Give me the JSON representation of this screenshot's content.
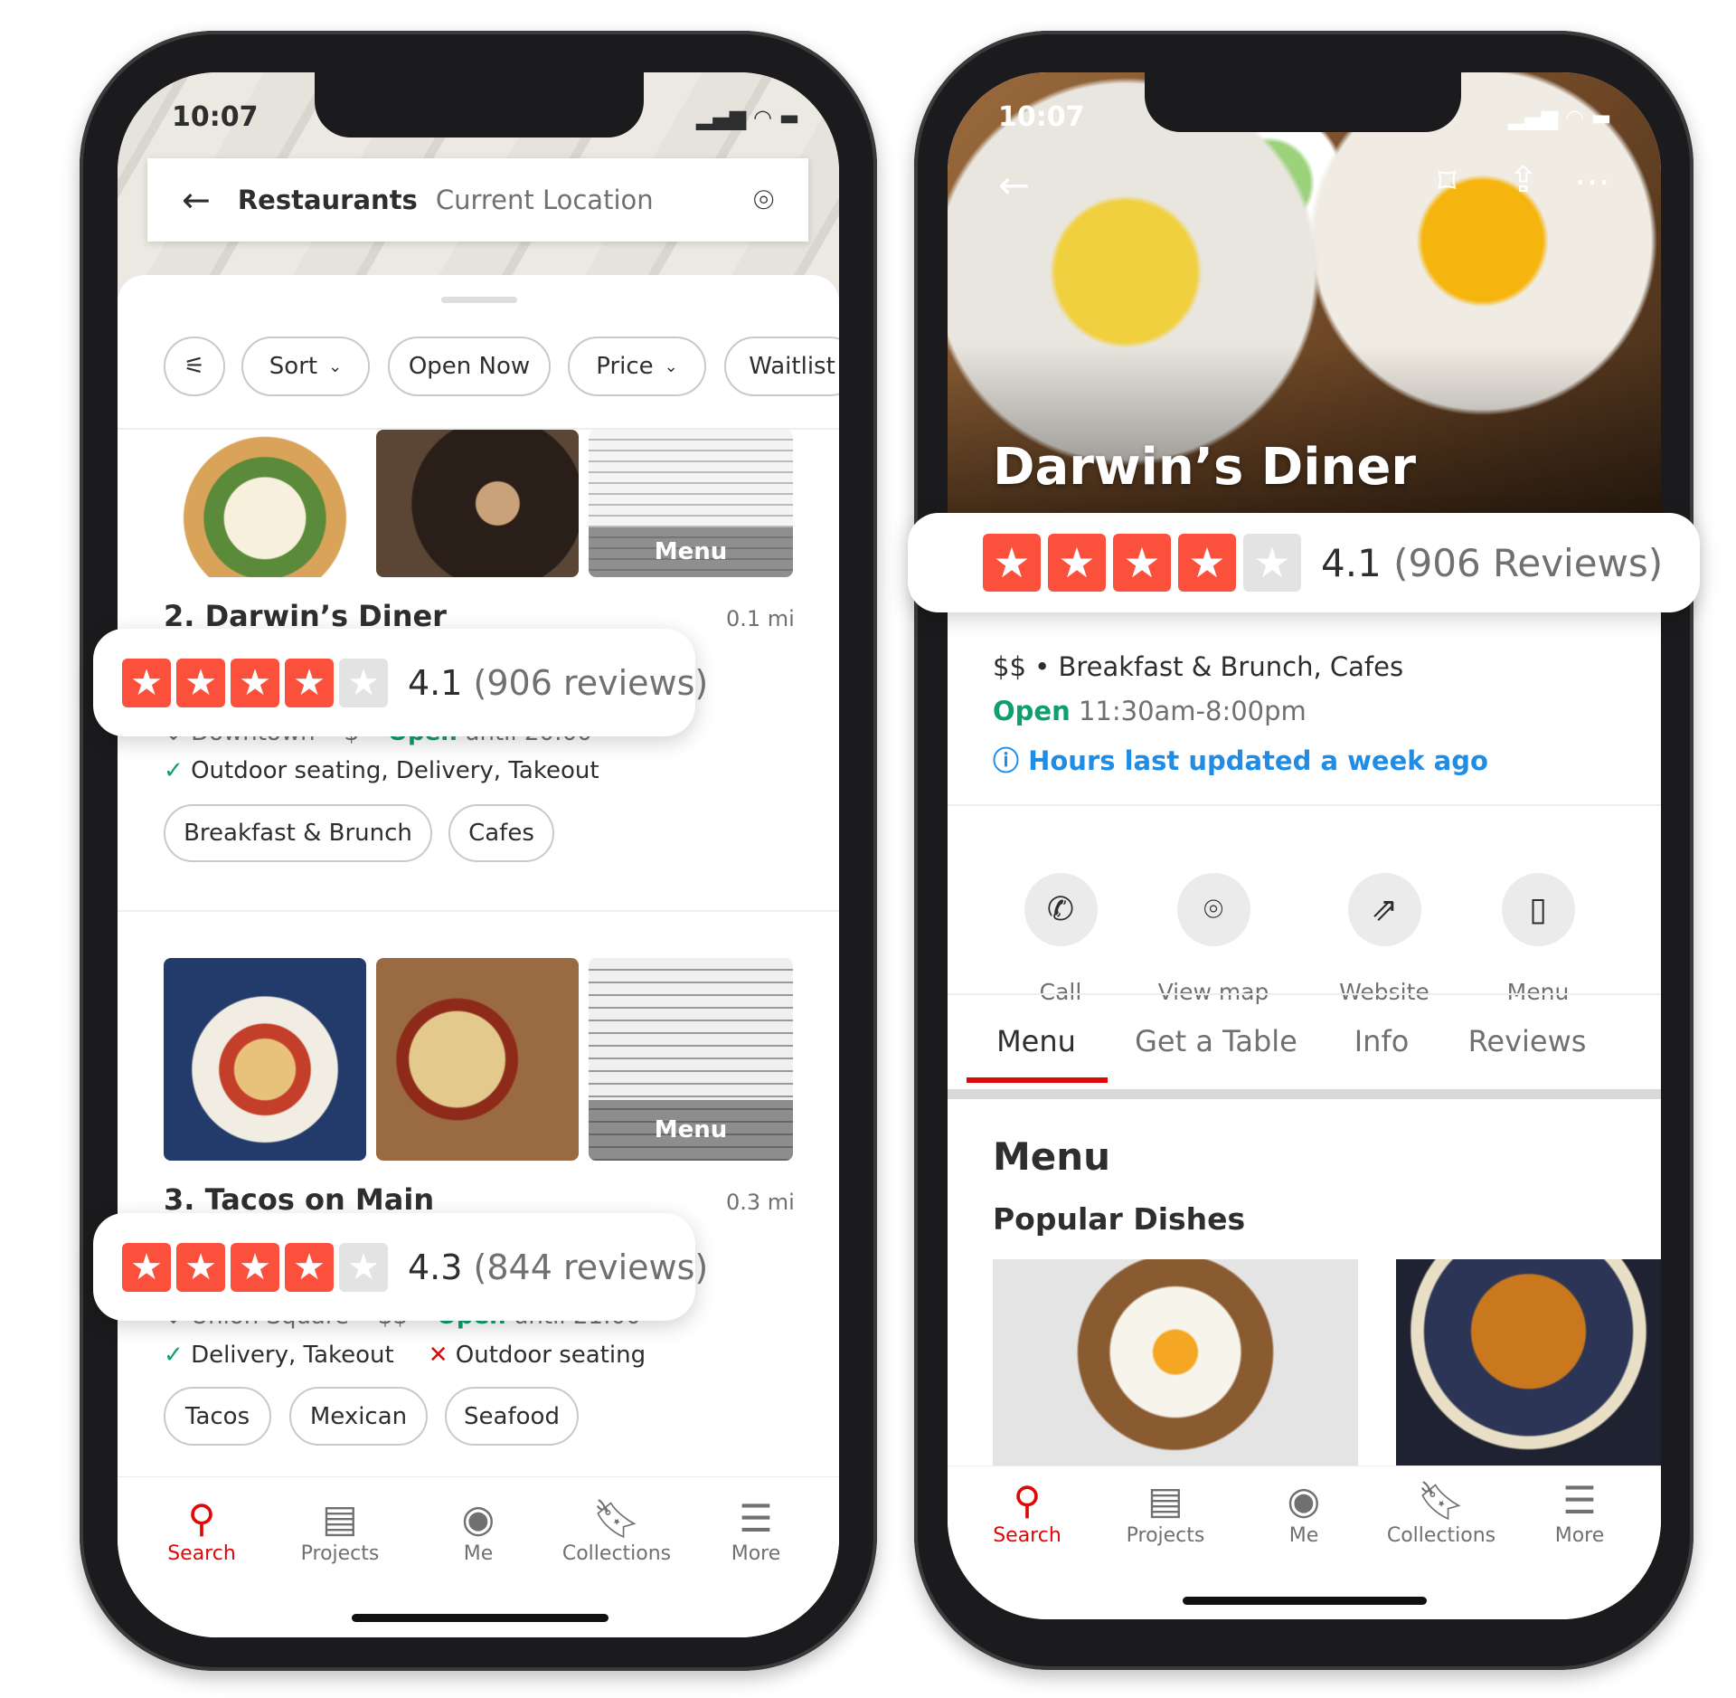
{
  "colors": {
    "star": "#fb503b",
    "star_empty": "#e3e3e3",
    "open": "#0f9f6e",
    "link": "#1f8ce6",
    "active_tab": "#e00707"
  },
  "left": {
    "status_time": "10:07",
    "search_bar": {
      "title": "Restaurants",
      "location": "Current Location",
      "back_icon": "arrow-left-icon",
      "map_icon": "map-pin-icon"
    },
    "filters": [
      {
        "label": "Sort",
        "dropdown": true
      },
      {
        "label": "Open Now"
      },
      {
        "label": "Price",
        "dropdown": true
      },
      {
        "label": "Waitlist"
      }
    ],
    "results": [
      {
        "title": "2. Darwin’s Diner",
        "distance": "0.1 mi",
        "rating": 4.1,
        "rating_text": "4.1",
        "reviews": "(906 reviews)",
        "neighborhood": "Downtown",
        "price": "$",
        "open": "Open",
        "hours": "until 20:00",
        "features_yes": "Outdoor seating, Delivery, Takeout",
        "features_no": "",
        "categories": [
          "Breakfast & Brunch",
          "Cafes"
        ],
        "photo_menu_label": "Menu"
      },
      {
        "title": "3. Tacos on Main",
        "distance": "0.3 mi",
        "rating": 4.3,
        "rating_text": "4.3",
        "reviews": "(844 reviews)",
        "neighborhood": "Union Square",
        "price": "$$",
        "open": "Open",
        "hours": "until 21:00",
        "features_yes": "Delivery, Takeout",
        "features_no": "Outdoor seating",
        "categories": [
          "Tacos",
          "Mexican",
          "Seafood"
        ],
        "photo_menu_label": "Menu"
      }
    ],
    "tabbar": [
      {
        "label": "Search",
        "icon": "search-icon",
        "active": true
      },
      {
        "label": "Projects",
        "icon": "projects-icon"
      },
      {
        "label": "Me",
        "icon": "user-icon"
      },
      {
        "label": "Collections",
        "icon": "bookmark-icon"
      },
      {
        "label": "More",
        "icon": "menu-icon"
      }
    ]
  },
  "right": {
    "status_time": "10:07",
    "business_name": "Darwin’s Diner",
    "rating": 4.1,
    "rating_text": "4.1",
    "reviews": "(906 Reviews)",
    "price_categories": "$$ • Breakfast & Brunch, Cafes",
    "open": "Open",
    "hours": "11:30am-8:00pm",
    "hours_note": "Hours last updated a week ago",
    "actions": [
      {
        "label": "Call",
        "icon": "phone-icon"
      },
      {
        "label": "View map",
        "icon": "map-pin-icon"
      },
      {
        "label": "Website",
        "icon": "external-link-icon"
      },
      {
        "label": "Menu",
        "icon": "menu-book-icon"
      }
    ],
    "tabs": [
      "Menu",
      "Get a Table",
      "Info",
      "Reviews"
    ],
    "active_tab": "Menu",
    "section_title": "Menu",
    "subsection_title": "Popular Dishes",
    "tabbar": [
      {
        "label": "Search",
        "icon": "search-icon",
        "active": true
      },
      {
        "label": "Projects",
        "icon": "projects-icon"
      },
      {
        "label": "Me",
        "icon": "user-icon"
      },
      {
        "label": "Collections",
        "icon": "bookmark-icon"
      },
      {
        "label": "More",
        "icon": "menu-icon"
      }
    ]
  }
}
